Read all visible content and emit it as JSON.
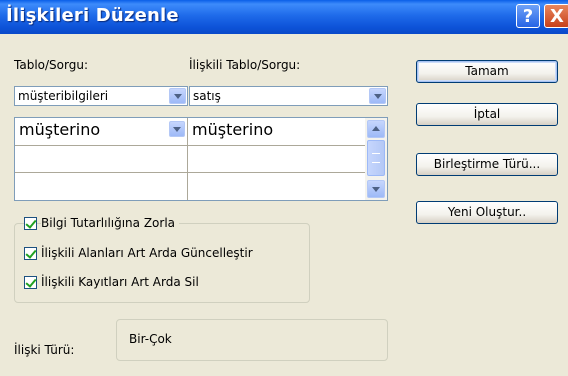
{
  "window": {
    "title": "İlişkileri Düzenle"
  },
  "titlebar_buttons": {
    "help": "?",
    "close": "X"
  },
  "labels": {
    "table_query": "Tablo/Sorgu:",
    "related_table_query": "İlişkili Tablo/Sorgu:"
  },
  "combos": {
    "table": "müşteribilgileri",
    "related_table": "satış"
  },
  "fields_grid": {
    "rows": [
      {
        "left": "müşterino",
        "right": "müşterino"
      },
      {
        "left": "",
        "right": ""
      },
      {
        "left": "",
        "right": ""
      }
    ]
  },
  "options": {
    "enforce_integrity": {
      "label": "Bilgi Tutarlılığına Zorla",
      "checked": true
    },
    "cascade_update": {
      "label": "İlişkili Alanları Art Arda Güncelleştir",
      "checked": true
    },
    "cascade_delete": {
      "label": "İlişkili Kayıtları Art Arda Sil",
      "checked": true
    }
  },
  "buttons": {
    "ok": "Tamam",
    "cancel": "İptal",
    "join_type": "Birleştirme Türü...",
    "create_new": "Yeni Oluştur.."
  },
  "relationship": {
    "label": "İlişki Türü:",
    "value": "Bir-Çok"
  }
}
